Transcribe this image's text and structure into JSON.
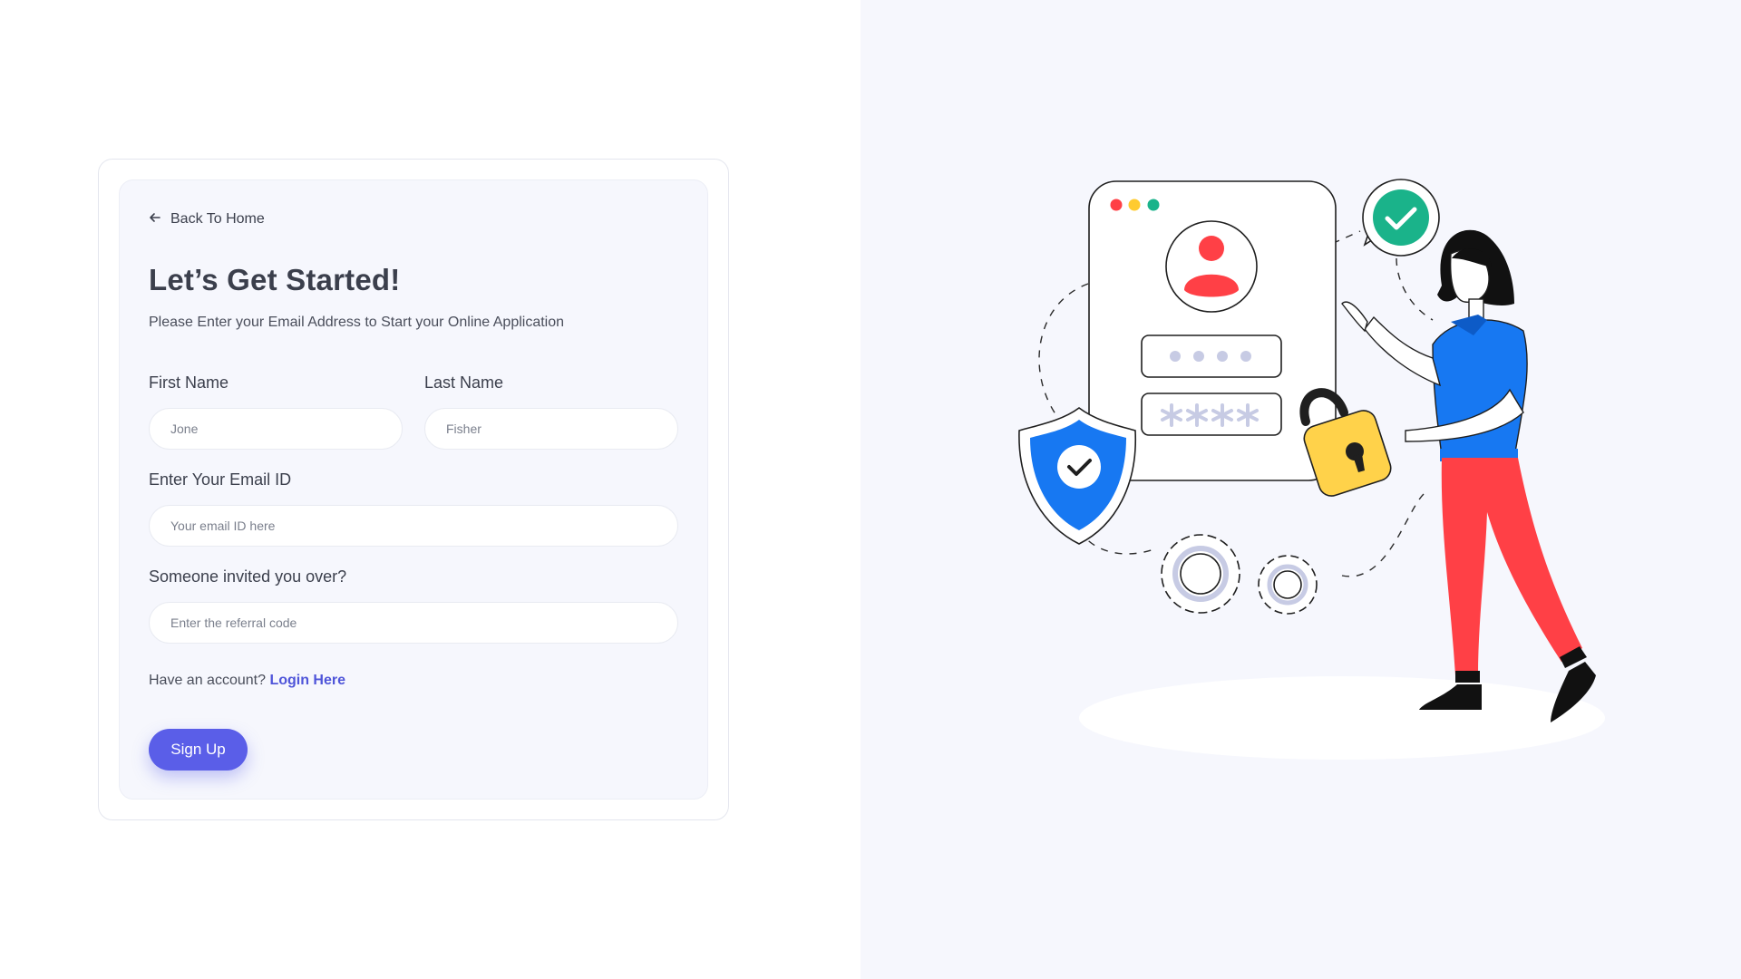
{
  "nav": {
    "back_label": "Back To Home"
  },
  "header": {
    "title": "Let’s Get Started!",
    "subtitle": "Please Enter your Email Address to Start your Online Application"
  },
  "form": {
    "first_name": {
      "label": "First Name",
      "placeholder": "Jone"
    },
    "last_name": {
      "label": "Last Name",
      "placeholder": "Fisher"
    },
    "email": {
      "label": "Enter Your Email ID",
      "placeholder": "Your email ID here"
    },
    "referral": {
      "label": "Someone invited you over?",
      "placeholder": "Enter the referral code"
    }
  },
  "account": {
    "prompt": "Have an account?",
    "login_label": "Login Here"
  },
  "signup": {
    "label": "Sign Up"
  },
  "colors": {
    "accent": "#5a5ee8",
    "link": "#4f55d9",
    "panel_bg": "#f6f7fd",
    "illustration_red": "#ff4046",
    "illustration_blue": "#1778f2",
    "illustration_yellow": "#ffd24a",
    "illustration_green": "#1ab38a"
  },
  "illustration": {
    "icons": [
      "user-avatar-icon",
      "password-dots-icon",
      "asterisks-icon",
      "shield-check-icon",
      "padlock-icon",
      "checkmark-badge-icon",
      "gear-icon",
      "window-dots-icon"
    ]
  }
}
